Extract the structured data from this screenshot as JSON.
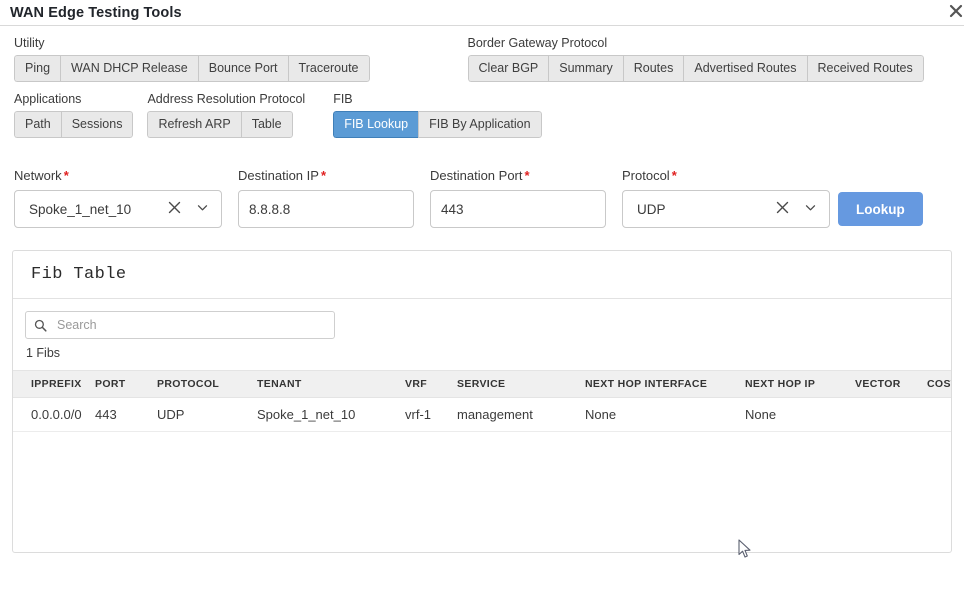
{
  "header": {
    "title": "WAN Edge Testing Tools",
    "close_icon": "close-icon"
  },
  "tool_groups": [
    {
      "label": "Utility",
      "name": "utility",
      "buttons": [
        {
          "label": "Ping",
          "active": false
        },
        {
          "label": "WAN DHCP Release",
          "active": false
        },
        {
          "label": "Bounce Port",
          "active": false
        },
        {
          "label": "Traceroute",
          "active": false
        }
      ]
    },
    {
      "label": "Border Gateway Protocol",
      "name": "bgp",
      "buttons": [
        {
          "label": "Clear BGP",
          "active": false
        },
        {
          "label": "Summary",
          "active": false
        },
        {
          "label": "Routes",
          "active": false
        },
        {
          "label": "Advertised Routes",
          "active": false
        },
        {
          "label": "Received Routes",
          "active": false
        }
      ]
    },
    {
      "label": "Applications",
      "name": "applications",
      "buttons": [
        {
          "label": "Path",
          "active": false
        },
        {
          "label": "Sessions",
          "active": false
        }
      ]
    },
    {
      "label": "Address Resolution Protocol",
      "name": "arp",
      "buttons": [
        {
          "label": "Refresh ARP",
          "active": false
        },
        {
          "label": "Table",
          "active": false
        }
      ]
    },
    {
      "label": "FIB",
      "name": "fib",
      "buttons": [
        {
          "label": "FIB Lookup",
          "active": true
        },
        {
          "label": "FIB By Application",
          "active": false
        }
      ]
    }
  ],
  "form": {
    "network": {
      "label": "Network",
      "required_marker": "*",
      "value": "Spoke_1_net_10",
      "clear_icon": "close-x-icon",
      "caret_icon": "chevron-down-icon"
    },
    "destination_ip": {
      "label": "Destination IP",
      "required_marker": "*",
      "value": "8.8.8.8",
      "placeholder": ""
    },
    "destination_port": {
      "label": "Destination Port",
      "required_marker": "*",
      "value": "443",
      "placeholder": ""
    },
    "protocol": {
      "label": "Protocol",
      "required_marker": "*",
      "value": "UDP",
      "clear_icon": "close-x-icon",
      "caret_icon": "chevron-down-icon"
    },
    "submit_label": "Lookup"
  },
  "card": {
    "title": "Fib Table",
    "search": {
      "placeholder": "Search",
      "value": "",
      "icon": "search-icon"
    },
    "count_label": "1 Fibs",
    "table": {
      "columns": [
        "IPPREFIX",
        "PORT",
        "PROTOCOL",
        "TENANT",
        "VRF",
        "SERVICE",
        "NEXT HOP INTERFACE",
        "NEXT HOP IP",
        "VECTOR",
        "COST"
      ],
      "rows": [
        {
          "ipprefix": "0.0.0.0/0",
          "port": "443",
          "protocol": "UDP",
          "tenant": "Spoke_1_net_10",
          "vrf": "vrf-1",
          "service": "management",
          "next_hop_interface": "None",
          "next_hop_ip": "None",
          "vector": "",
          "cost": ""
        }
      ]
    }
  },
  "colors": {
    "accent_blue": "#5b9bd5",
    "button_blue": "#6699e0",
    "required_red": "#e02020",
    "button_gray": "#e9e9e9",
    "header_gray": "#f0f0f0"
  }
}
